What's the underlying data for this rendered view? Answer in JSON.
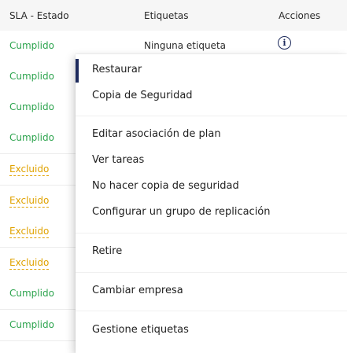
{
  "table": {
    "headers": {
      "status": "SLA - Estado",
      "tags": "Etiquetas",
      "actions": "Acciones"
    },
    "rows": [
      {
        "status": "Cumplido",
        "kind": "ok",
        "tags": "Ninguna etiqueta"
      },
      {
        "status": "Cumplido",
        "kind": "ok"
      },
      {
        "status": "Cumplido",
        "kind": "ok"
      },
      {
        "status": "Cumplido",
        "kind": "ok"
      },
      {
        "status": "Excluido",
        "kind": "ex"
      },
      {
        "status": "Excluido",
        "kind": "ex"
      },
      {
        "status": "Excluido",
        "kind": "ex"
      },
      {
        "status": "Excluido",
        "kind": "ex"
      },
      {
        "status": "Cumplido",
        "kind": "ok"
      },
      {
        "status": "Cumplido",
        "kind": "ok"
      }
    ]
  },
  "actions_icon": "info-circle-icon",
  "menu": {
    "items": [
      {
        "label": "Restaurar",
        "active": true
      },
      {
        "label": "Copia de Seguridad"
      },
      {
        "label": "Editar asociación de plan"
      },
      {
        "label": "Ver tareas"
      },
      {
        "label": "No hacer copia de seguridad"
      },
      {
        "label": "Configurar un grupo de replicación"
      },
      {
        "label": "Retire"
      },
      {
        "label": "Cambiar empresa"
      },
      {
        "label": "Gestione etiquetas"
      }
    ]
  },
  "colors": {
    "accent": "#1d2a5c",
    "status_ok": "#2ea44f",
    "status_excluded": "#e0a200"
  }
}
